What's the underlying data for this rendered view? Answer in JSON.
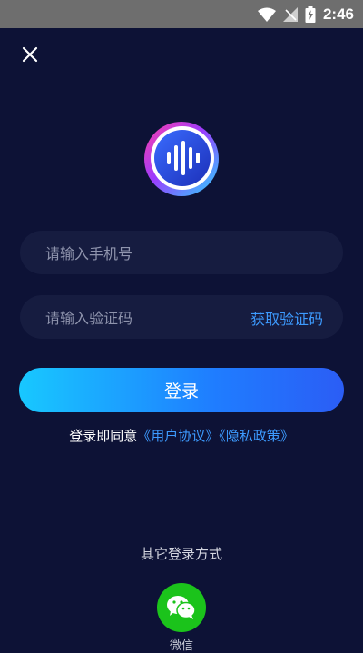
{
  "status_bar": {
    "time": "2:46"
  },
  "form": {
    "phone_placeholder": "请输入手机号",
    "code_placeholder": "请输入验证码",
    "get_code_label": "获取验证码",
    "login_label": "登录"
  },
  "agreement": {
    "prefix": "登录即同意",
    "user_agreement": "《用户协议》",
    "privacy_policy": "《隐私政策》"
  },
  "other_login": {
    "title": "其它登录方式",
    "wechat_label": "微信"
  },
  "colors": {
    "background": "#0d1236",
    "accent": "#3d9bff",
    "wechat": "#1bc31b"
  }
}
